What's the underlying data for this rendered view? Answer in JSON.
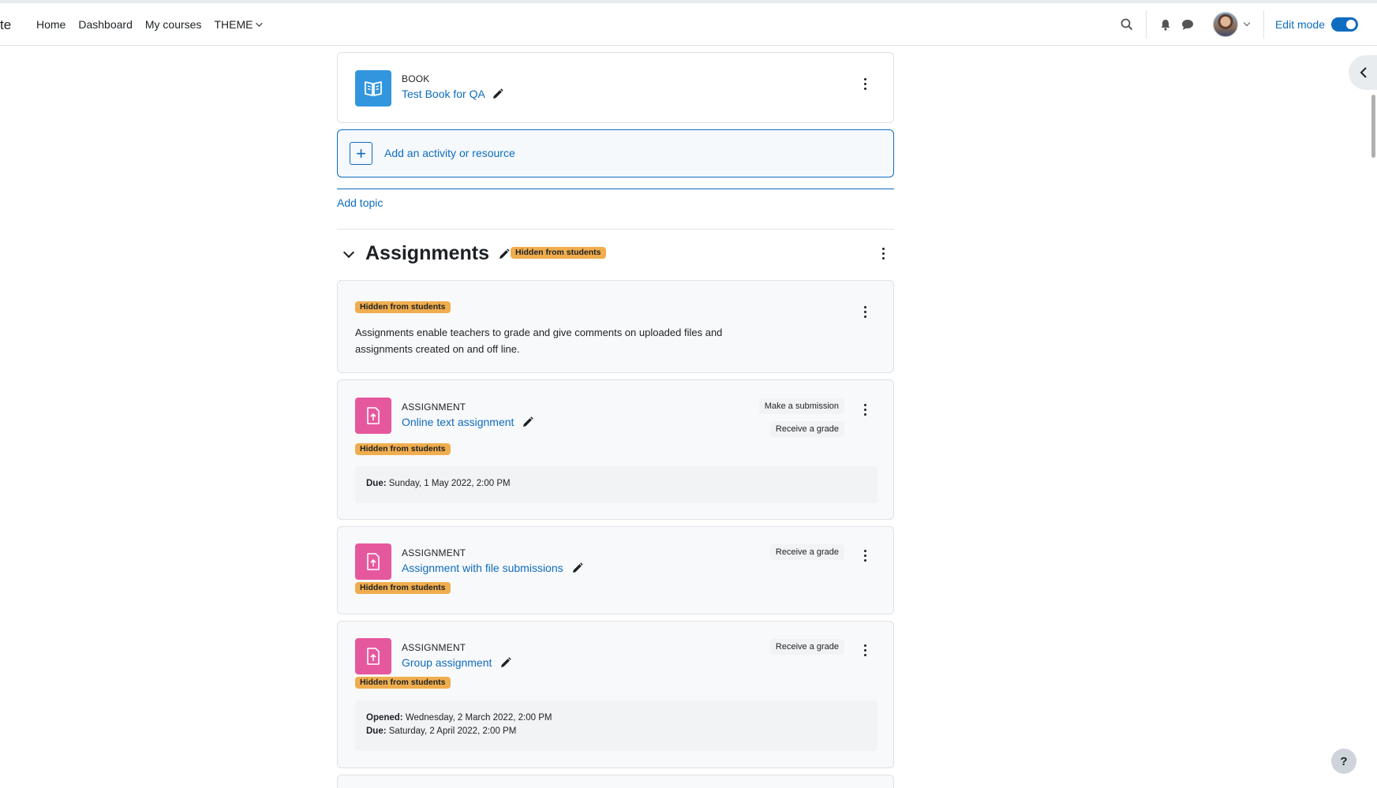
{
  "navbar": {
    "brand_fragment": "te",
    "links": [
      "Home",
      "Dashboard",
      "My courses",
      "THEME"
    ],
    "edit_mode_label": "Edit mode",
    "edit_mode_on": true
  },
  "book": {
    "type": "BOOK",
    "name": "Test Book for QA"
  },
  "add_activity_label": "Add an activity or resource",
  "add_topic_label": "Add topic",
  "section": {
    "title": "Assignments",
    "badge": "Hidden from students",
    "summary_badge": "Hidden from students",
    "summary": "Assignments enable teachers to grade and give comments on uploaded files and assignments created on and off line."
  },
  "assignments": [
    {
      "type": "ASSIGNMENT",
      "name": "Online text assignment",
      "badge": "Hidden from students",
      "completion": [
        "Make a submission",
        "Receive a grade"
      ],
      "dates": [
        {
          "label": "Due:",
          "value": "Sunday, 1 May 2022, 2:00 PM"
        }
      ]
    },
    {
      "type": "ASSIGNMENT",
      "name": "Assignment with file submissions",
      "badge": "Hidden from students",
      "completion": [
        "Receive a grade"
      ]
    },
    {
      "type": "ASSIGNMENT",
      "name": "Group assignment",
      "badge": "Hidden from students",
      "completion": [
        "Receive a grade"
      ],
      "dates": [
        {
          "label": "Opened:",
          "value": "Wednesday, 2 March 2022, 2:00 PM"
        },
        {
          "label": "Due:",
          "value": "Saturday, 2 April 2022, 2:00 PM"
        }
      ]
    }
  ],
  "help_label": "?",
  "colors": {
    "link": "#0f6cbf",
    "badge_warning": "#f0ad4e",
    "book_icon": "#3296de",
    "assignment_icon": "#e6589e"
  },
  "icons": {
    "search": "search-icon",
    "bell": "bell-icon",
    "chat": "chat-icon",
    "pencil": "pencil-icon",
    "kebab": "kebab-icon"
  }
}
